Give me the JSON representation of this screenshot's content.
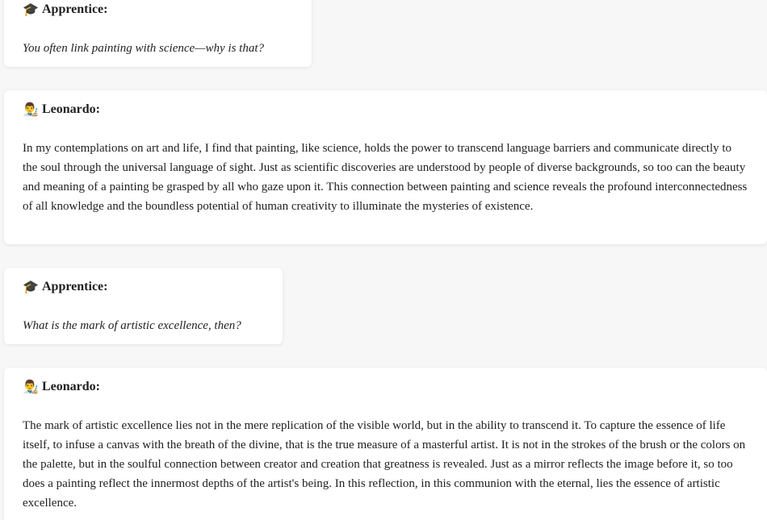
{
  "conversation": [
    {
      "speaker_icon": "🎓",
      "speaker_icon_name": "graduation-cap-icon",
      "speaker": "Apprentice:",
      "text": "You often link painting with science—why is that?"
    },
    {
      "speaker_icon": "👨‍🎨",
      "speaker_icon_name": "artist-icon",
      "speaker": "Leonardo:",
      "text": "In my contemplations on art and life, I find that painting, like science, holds the power to transcend language barriers and communicate directly to the soul through the universal language of sight. Just as scientific discoveries are understood by people of diverse backgrounds, so too can the beauty and meaning of a painting be grasped by all who gaze upon it. This connection between painting and science reveals the profound interconnectedness of all knowledge and the boundless potential of human creativity to illuminate the mysteries of existence."
    },
    {
      "speaker_icon": "🎓",
      "speaker_icon_name": "graduation-cap-icon",
      "speaker": "Apprentice:",
      "text": "What is the mark of artistic excellence, then?"
    },
    {
      "speaker_icon": "👨‍🎨",
      "speaker_icon_name": "artist-icon",
      "speaker": "Leonardo:",
      "text": "The mark of artistic excellence lies not in the mere replication of the visible world, but in the ability to transcend it. To capture the essence of life itself, to infuse a canvas with the breath of the divine, that is the true measure of a masterful artist. It is not in the strokes of the brush or the colors on the palette, but in the soulful connection between creator and creation that greatness is revealed. Just as a mirror reflects the image before it, so too does a painting reflect the innermost depths of the artist's being. In this reflection, in this communion with the eternal, lies the essence of artistic excellence."
    }
  ]
}
